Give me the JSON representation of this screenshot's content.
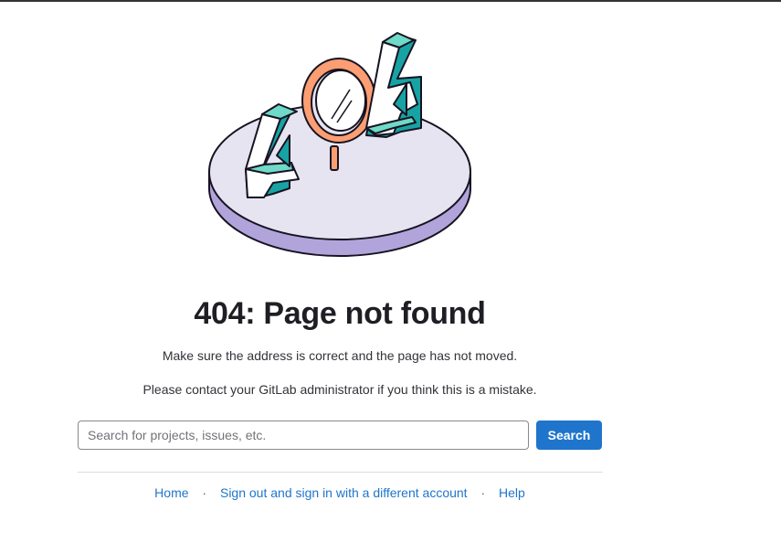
{
  "page": {
    "title": "404: Page not found",
    "message": "Make sure the address is correct and the page has not moved.",
    "contact": "Please contact your GitLab administrator if you think this is a mistake."
  },
  "search": {
    "placeholder": "Search for projects, issues, etc.",
    "value": "",
    "button_label": "Search"
  },
  "footer": {
    "links": [
      {
        "label": "Home"
      },
      {
        "label": "Sign out and sign in with a different account"
      },
      {
        "label": "Help"
      }
    ],
    "separator": "·"
  },
  "illustration": {
    "icon": "404-magnifying-glass-illustration",
    "colors": {
      "platform_top": "#e7e4f2",
      "platform_side": "#b1a4db",
      "digit_teal": "#6fdac7",
      "digit_dark_teal": "#17a3a4",
      "magnifier": "#fc9e72",
      "outline": "#171321"
    }
  },
  "colors": {
    "accent": "#1f75cb",
    "text": "#333238",
    "heading": "#1f1e24"
  }
}
